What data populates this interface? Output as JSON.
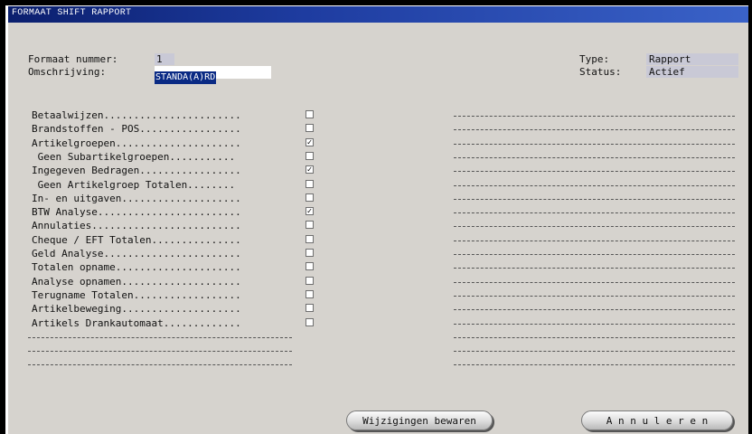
{
  "window": {
    "title": "FORMAAT SHIFT RAPPORT"
  },
  "header": {
    "format_number_label": "Formaat nummer:",
    "format_number_value": "1",
    "description_label": "Omschrijving:",
    "description_value": "STANDA(A)RD",
    "type_label": "Type:",
    "type_value": "Rapport",
    "status_label": "Status:",
    "status_value": "Actief"
  },
  "options": [
    {
      "label": "Betaalwijzen.......................",
      "checked": false
    },
    {
      "label": "Brandstoffen - POS.................",
      "checked": false
    },
    {
      "label": "Artikelgroepen.....................",
      "checked": true
    },
    {
      "label": " Geen Subartikelgroepen...........",
      "checked": false
    },
    {
      "label": "Ingegeven Bedragen.................",
      "checked": true
    },
    {
      "label": " Geen Artikelgroep Totalen........",
      "checked": false
    },
    {
      "label": "In- en uitgaven....................",
      "checked": false
    },
    {
      "label": "BTW Analyse........................",
      "checked": true
    },
    {
      "label": "Annulaties.........................",
      "checked": false
    },
    {
      "label": "Cheque / EFT Totalen...............",
      "checked": false
    },
    {
      "label": "Geld Analyse.......................",
      "checked": false
    },
    {
      "label": "Totalen opname.....................",
      "checked": false
    },
    {
      "label": "Analyse opnamen....................",
      "checked": false
    },
    {
      "label": "Terugname Totalen..................",
      "checked": false
    },
    {
      "label": "Artikelbeweging....................",
      "checked": false
    },
    {
      "label": "Artikels Drankautomaat.............",
      "checked": false
    }
  ],
  "buttons": {
    "save": "Wijzigingen bewaren",
    "cancel": "A n n u l e r e n"
  }
}
